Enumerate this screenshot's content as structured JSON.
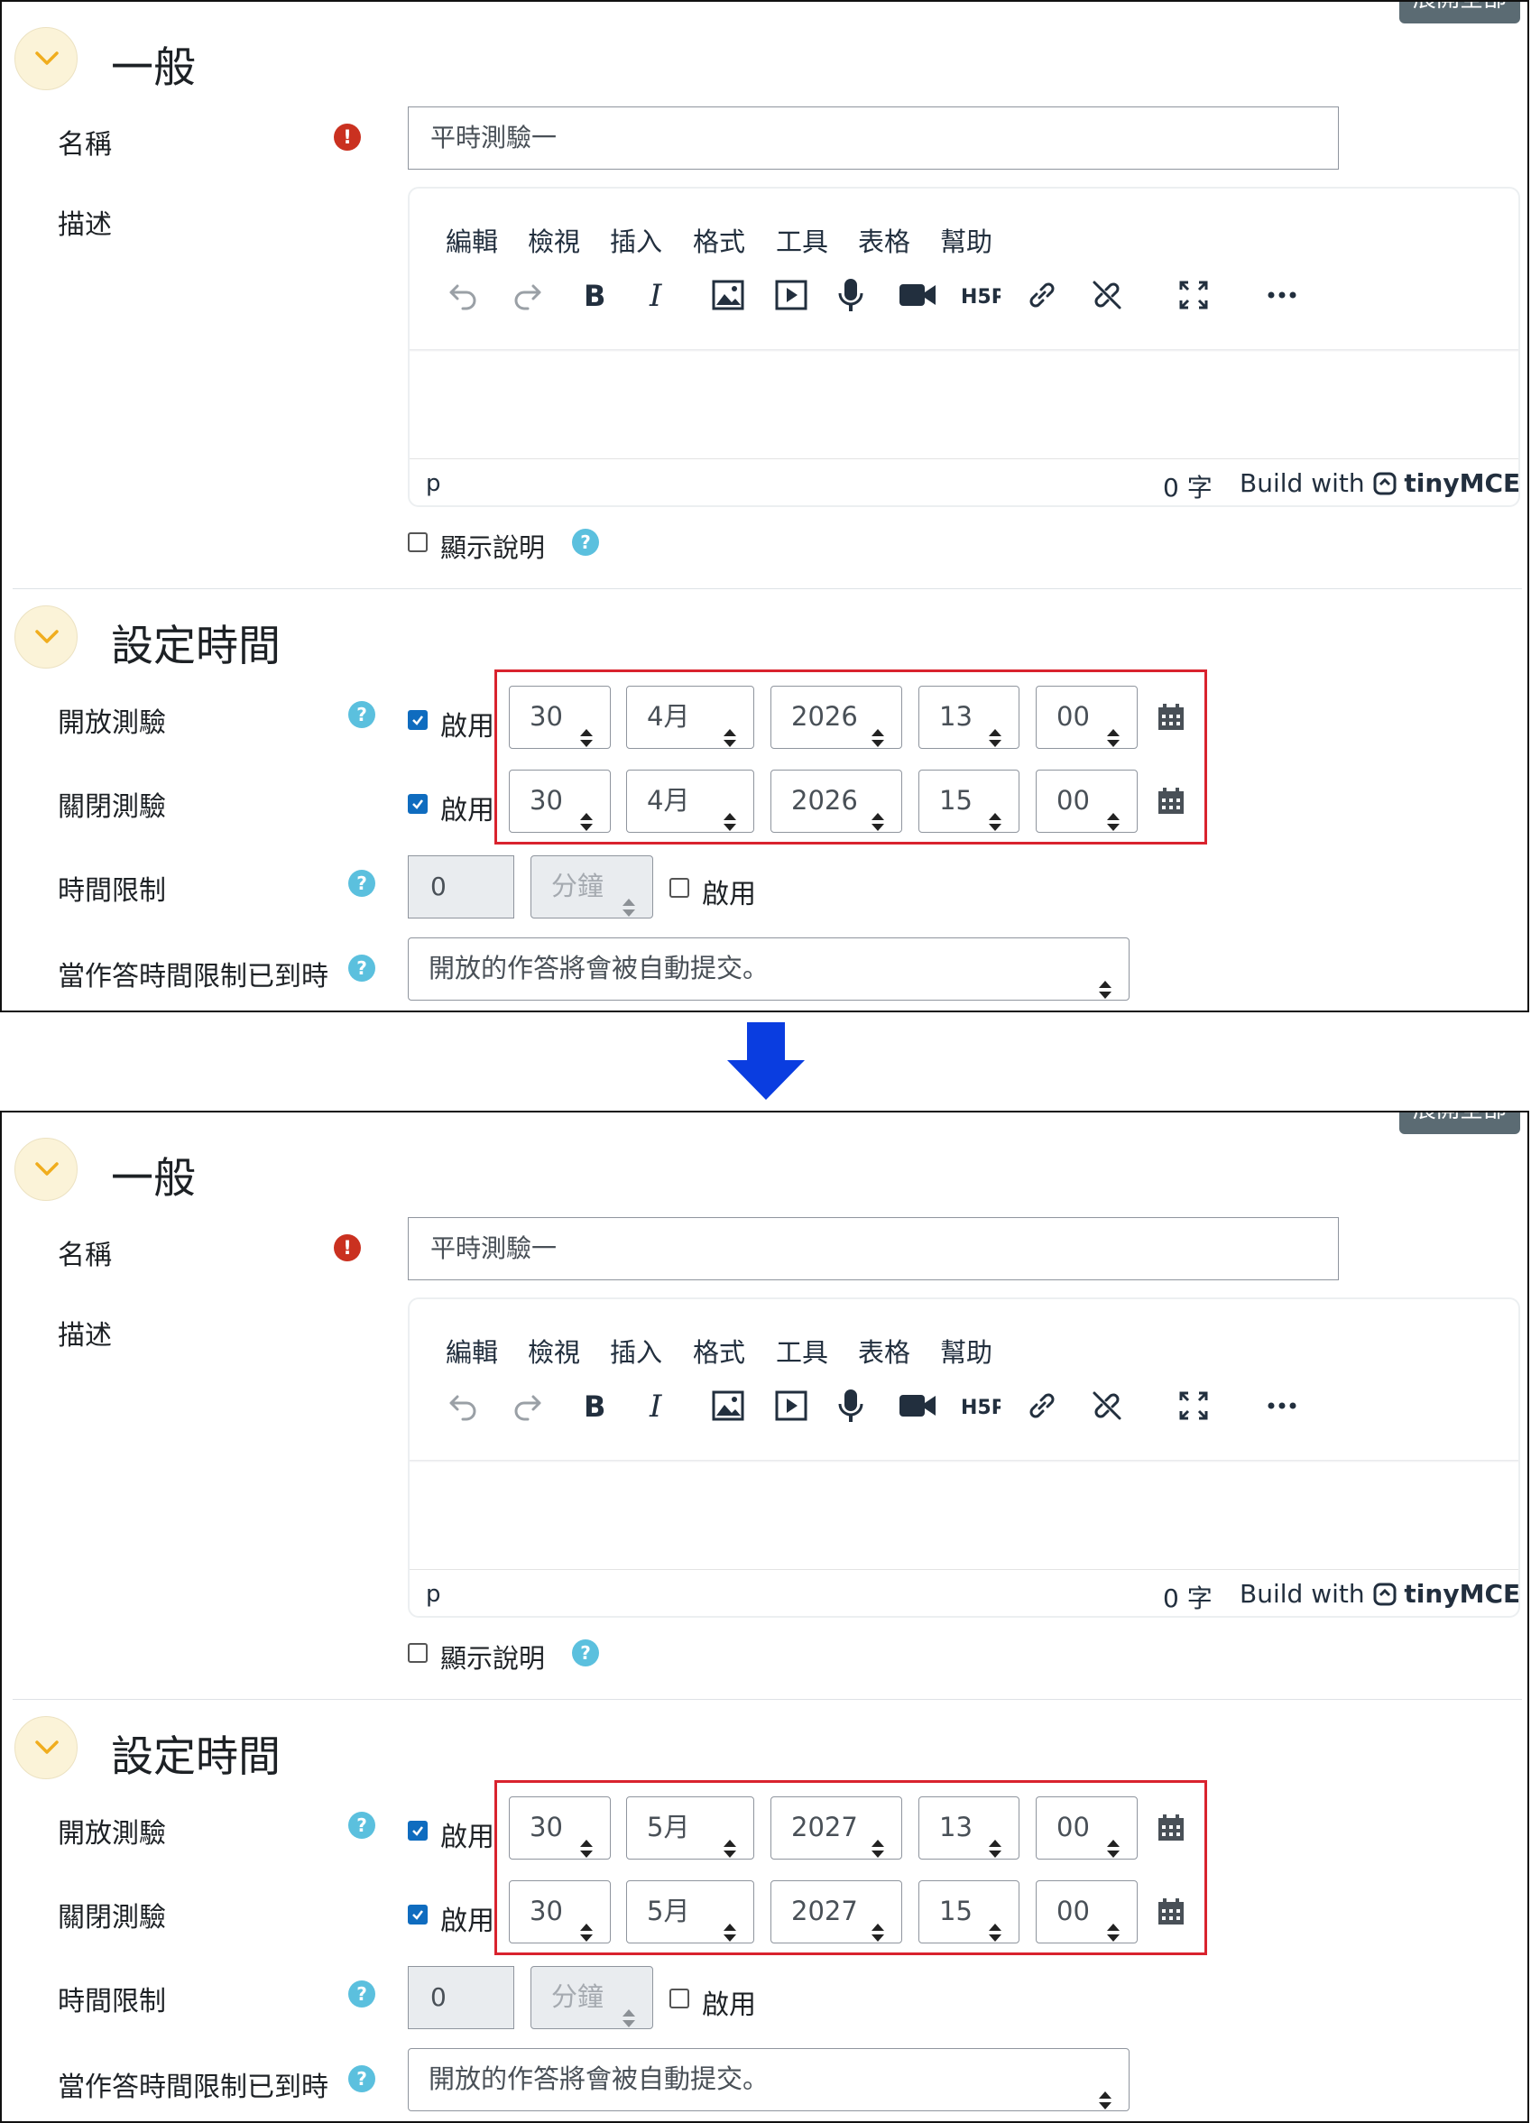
{
  "expand_all_label": "展開全部",
  "arrow": "down-arrow",
  "panels": [
    {
      "id": "before",
      "section_general": {
        "title": "一般",
        "name_label": "名稱",
        "name_value": "平時測驗一",
        "desc_label": "描述",
        "editor_menu": [
          "編輯",
          "檢視",
          "插入",
          "格式",
          "工具",
          "表格",
          "幫助"
        ],
        "status_path": "p",
        "word_count": "0 字",
        "brand_prefix": "Build with",
        "brand_name": "tinyMCE",
        "show_desc_label": "顯示說明"
      },
      "section_timing": {
        "title": "設定時間",
        "open_label": "開放測驗",
        "close_label": "關閉測驗",
        "enable_label": "啟用",
        "open": {
          "day": "30",
          "month": "4月",
          "year": "2026",
          "hour": "13",
          "minute": "00"
        },
        "close": {
          "day": "30",
          "month": "4月",
          "year": "2026",
          "hour": "15",
          "minute": "00"
        },
        "time_limit_label": "時間限制",
        "time_limit_value": "0",
        "time_limit_unit": "分鐘",
        "when_expire_label": "當作答時間限制已到時",
        "when_expire_value": "開放的作答將會被自動提交。"
      }
    },
    {
      "id": "after",
      "section_general": {
        "title": "一般",
        "name_label": "名稱",
        "name_value": "平時測驗一",
        "desc_label": "描述",
        "editor_menu": [
          "編輯",
          "檢視",
          "插入",
          "格式",
          "工具",
          "表格",
          "幫助"
        ],
        "status_path": "p",
        "word_count": "0 字",
        "brand_prefix": "Build with",
        "brand_name": "tinyMCE",
        "show_desc_label": "顯示說明"
      },
      "section_timing": {
        "title": "設定時間",
        "open_label": "開放測驗",
        "close_label": "關閉測驗",
        "enable_label": "啟用",
        "open": {
          "day": "30",
          "month": "5月",
          "year": "2027",
          "hour": "13",
          "minute": "00"
        },
        "close": {
          "day": "30",
          "month": "5月",
          "year": "2027",
          "hour": "15",
          "minute": "00"
        },
        "time_limit_label": "時間限制",
        "time_limit_value": "0",
        "time_limit_unit": "分鐘",
        "when_expire_label": "當作答時間限制已到時",
        "when_expire_value": "開放的作答將會被自動提交。"
      }
    }
  ],
  "toolbar_icons": [
    "undo-icon",
    "redo-icon",
    "bold-icon",
    "italic-icon",
    "image-icon",
    "media-icon",
    "microphone-icon",
    "video-camera-icon",
    "h5p-icon",
    "link-icon",
    "unlink-icon",
    "fullscreen-icon",
    "more-icon"
  ],
  "colors": {
    "accent": "#0f6cbf",
    "required": "#ca3120",
    "help": "#5bc0de",
    "highlight": "#d9232e",
    "arrow": "#0a3de0"
  }
}
